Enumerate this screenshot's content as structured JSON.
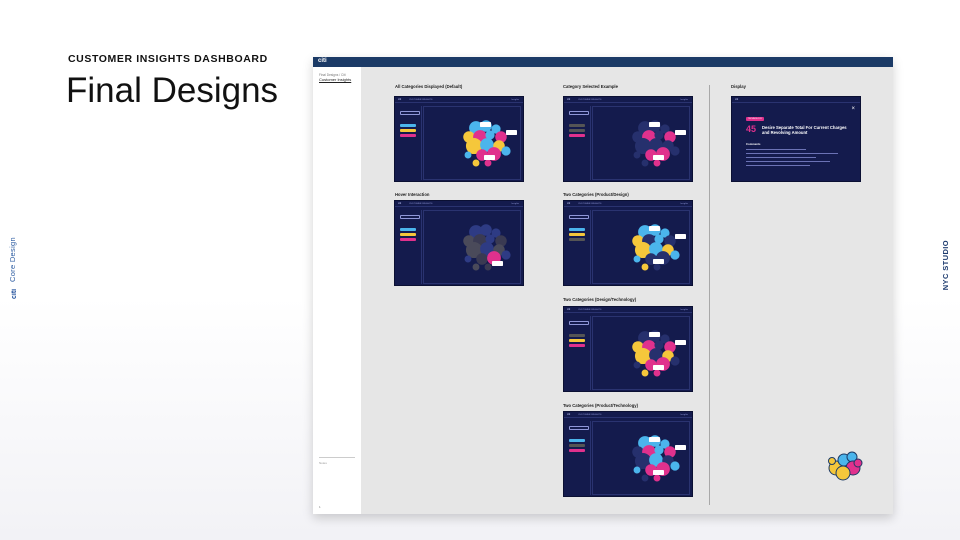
{
  "slide": {
    "eyebrow": "CUSTOMER INSIGHTS DASHBOARD",
    "title": "Final Designs",
    "brand_text": "Core Design",
    "brand_mark": "citi",
    "studio": "NYC STUDIO"
  },
  "frame": {
    "logo": "citi",
    "breadcrumb": "Final Designs / Citi",
    "breadcrumb_link": "Customer Insights",
    "footer_note": "Notes",
    "page_number": "1"
  },
  "sections": [
    {
      "label": "All Categories Displayed (Default)",
      "variant": "all"
    },
    {
      "label": "Hover Interaction",
      "variant": "hover"
    },
    {
      "label": "Category Selected Example",
      "variant": "pink"
    },
    {
      "label": "Two Categories (Product/Design)",
      "variant": "blue-yellow"
    },
    {
      "label": "Two Categories (Design/Technology)",
      "variant": "yellow-pink"
    },
    {
      "label": "Two Categories (Product/Technology)",
      "variant": "blue-pink"
    },
    {
      "label": "Display",
      "variant": "display"
    }
  ],
  "mini": {
    "app_title": "citi",
    "app_name": "CUSTOMER INSIGHTS",
    "nav": "Insights"
  },
  "detail": {
    "pill": "TECHNOLOGY",
    "number": "45",
    "headline": "Desire Separate Total For Current Charges and Revolving Amount",
    "sub": "Comments",
    "close": "×"
  },
  "colors": {
    "navy": "#141b4d",
    "blue": "#4bb5ec",
    "yellow": "#f5c73b",
    "pink": "#e0318d",
    "frame_bar": "#1b3a66"
  }
}
